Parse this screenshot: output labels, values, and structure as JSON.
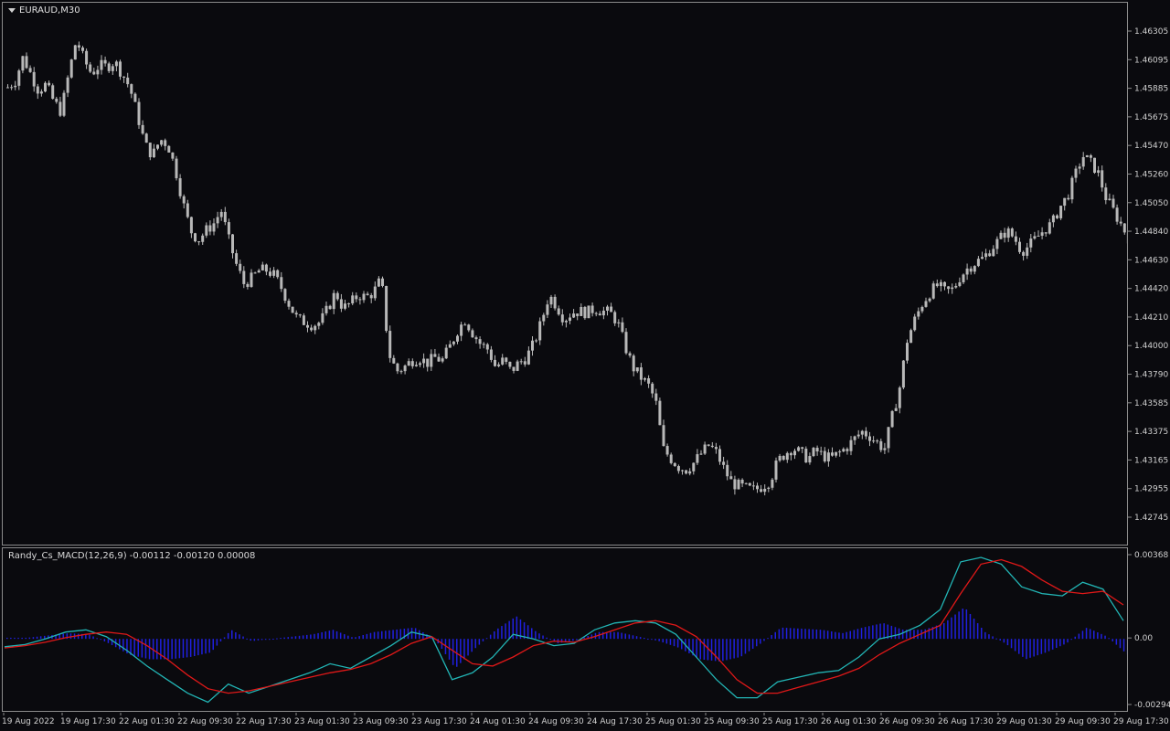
{
  "symbol": "EURAUD,M30",
  "indicator_label": "Randy_Cs_MACD(12,26,9) -0.00112 -0.00120 0.00008",
  "colors": {
    "background": "#0a0a0e",
    "candle": "#b8b8b8",
    "grid_border": "#8c8c8c",
    "macd_line": "#22b5b5",
    "signal_line": "#e01818",
    "histogram": "#2020e0"
  },
  "chart_data": [
    {
      "type": "candlestick",
      "title": "EURAUD,M30",
      "y_ticks": [
        "1.46305",
        "1.46095",
        "1.45885",
        "1.45675",
        "1.45470",
        "1.45260",
        "1.45050",
        "1.44840",
        "1.44630",
        "1.44420",
        "1.44210",
        "1.44000",
        "1.43790",
        "1.43585",
        "1.43375",
        "1.43165",
        "1.42955",
        "1.42745"
      ],
      "ylim": [
        1.42745,
        1.46305
      ],
      "close_path": [
        1.459,
        1.4595,
        1.4612,
        1.46,
        1.4588,
        1.4592,
        1.458,
        1.4572,
        1.46,
        1.4625,
        1.461,
        1.46,
        1.4606,
        1.4605,
        1.4609,
        1.46,
        1.459,
        1.457,
        1.4548,
        1.454,
        1.4552,
        1.4548,
        1.453,
        1.4505,
        1.4485,
        1.4478,
        1.4485,
        1.449,
        1.45,
        1.4478,
        1.446,
        1.4446,
        1.445,
        1.4456,
        1.4456,
        1.4452,
        1.4442,
        1.443,
        1.442,
        1.4418,
        1.4416,
        1.4418,
        1.4428,
        1.444,
        1.4428,
        1.4432,
        1.4438,
        1.4436,
        1.444,
        1.445,
        1.4395,
        1.4382,
        1.4385,
        1.439,
        1.4392,
        1.4388,
        1.4392,
        1.439,
        1.44,
        1.4412,
        1.442,
        1.441,
        1.4402,
        1.4398,
        1.4385,
        1.439,
        1.4382,
        1.4388,
        1.4392,
        1.4402,
        1.4418,
        1.4438,
        1.443,
        1.442,
        1.4425,
        1.4426,
        1.4425,
        1.4428,
        1.4426,
        1.4425,
        1.4418,
        1.44,
        1.4385,
        1.4378,
        1.4372,
        1.436,
        1.4325,
        1.4318,
        1.4312,
        1.431,
        1.4315,
        1.4322,
        1.4328,
        1.4322,
        1.431,
        1.43,
        1.4298,
        1.4296,
        1.4295,
        1.4298,
        1.4302,
        1.4316,
        1.4322,
        1.4326,
        1.4322,
        1.4318,
        1.4324,
        1.432,
        1.4318,
        1.4322,
        1.4326,
        1.4332,
        1.4338,
        1.4335,
        1.433,
        1.4325,
        1.4348,
        1.437,
        1.4405,
        1.442,
        1.4432,
        1.444,
        1.4445,
        1.444,
        1.4442,
        1.4452,
        1.4458,
        1.4462,
        1.4465,
        1.4472,
        1.4478,
        1.4485,
        1.448,
        1.447,
        1.4474,
        1.448,
        1.4486,
        1.449,
        1.4502,
        1.451,
        1.4525,
        1.454,
        1.4535,
        1.4528,
        1.451,
        1.45,
        1.449,
        1.448
      ]
    },
    {
      "type": "line",
      "title": "Randy_Cs_MACD(12,26,9) -0.00112 -0.00120 0.00008",
      "y_ticks": [
        "0.00368",
        "0.00",
        "-0.00294"
      ],
      "ylim": [
        -0.00294,
        0.00368
      ],
      "x_ticks": [
        "19 Aug 2022",
        "19 Aug 17:30",
        "22 Aug 01:30",
        "22 Aug 09:30",
        "22 Aug 17:30",
        "23 Aug 01:30",
        "23 Aug 09:30",
        "23 Aug 17:30",
        "24 Aug 01:30",
        "24 Aug 09:30",
        "24 Aug 17:30",
        "25 Aug 01:30",
        "25 Aug 09:30",
        "25 Aug 17:30",
        "26 Aug 01:30",
        "26 Aug 09:30",
        "26 Aug 17:30",
        "29 Aug 01:30",
        "29 Aug 09:30",
        "29 Aug 17:30"
      ],
      "macd": [
        -0.00035,
        -0.00025,
        0.0,
        0.0003,
        0.0004,
        0.0001,
        -0.0005,
        -0.0012,
        -0.0018,
        -0.0024,
        -0.0028,
        -0.002,
        -0.0024,
        -0.0021,
        -0.0018,
        -0.0015,
        -0.0011,
        -0.0013,
        -0.0008,
        -0.0003,
        0.0003,
        0.0001,
        -0.0018,
        -0.0015,
        -0.0008,
        0.0002,
        0.0,
        -0.0003,
        -0.0002,
        0.0004,
        0.0007,
        0.0008,
        0.0007,
        0.0002,
        -0.0008,
        -0.0018,
        -0.0026,
        -0.0026,
        -0.0019,
        -0.0017,
        -0.0015,
        -0.0014,
        -0.0008,
        0.0,
        0.0002,
        0.0006,
        0.0013,
        0.0034,
        0.0036,
        0.0033,
        0.0023,
        0.002,
        0.0019,
        0.0025,
        0.0022,
        0.0008
      ],
      "signal": [
        -0.0004,
        -0.0003,
        -0.00015,
        5e-05,
        0.0002,
        0.0003,
        0.0002,
        -0.0003,
        -0.0009,
        -0.0016,
        -0.0022,
        -0.0024,
        -0.0023,
        -0.0021,
        -0.0019,
        -0.0017,
        -0.0015,
        -0.00135,
        -0.0011,
        -0.0007,
        -0.0002,
        0.0001,
        -0.0005,
        -0.0011,
        -0.0012,
        -0.0008,
        -0.0003,
        -0.0001,
        -0.00015,
        0.0001,
        0.0004,
        0.0007,
        0.0008,
        0.0006,
        0.0001,
        -0.0008,
        -0.0018,
        -0.0024,
        -0.0024,
        -0.00215,
        -0.0019,
        -0.00165,
        -0.0013,
        -0.0007,
        -0.0002,
        0.0002,
        0.0006,
        0.002,
        0.0033,
        0.0035,
        0.0032,
        0.0026,
        0.0021,
        0.002,
        0.0021,
        0.0015
      ],
      "histogram": [
        5e-05,
        5e-05,
        0.00015,
        0.00025,
        0.0002,
        -0.0002,
        -0.0007,
        -0.0009,
        -0.0009,
        -0.0008,
        -0.0006,
        0.0004,
        -0.0001,
        0.0,
        0.0001,
        0.0002,
        0.0004,
        5e-05,
        0.0003,
        0.0004,
        0.0005,
        0.0,
        -0.0013,
        -0.0004,
        0.0004,
        0.001,
        0.0003,
        -0.0002,
        -5e-05,
        0.0003,
        0.0003,
        0.0001,
        -0.0001,
        -0.0004,
        -0.0009,
        -0.001,
        -0.0008,
        -0.0002,
        0.0005,
        0.00045,
        0.0004,
        0.00025,
        0.0005,
        0.0007,
        0.0004,
        0.0004,
        0.0007,
        0.0014,
        0.0003,
        -0.0002,
        -0.0009,
        -0.0006,
        -0.0002,
        0.0005,
        0.0001,
        -0.0007
      ]
    }
  ]
}
